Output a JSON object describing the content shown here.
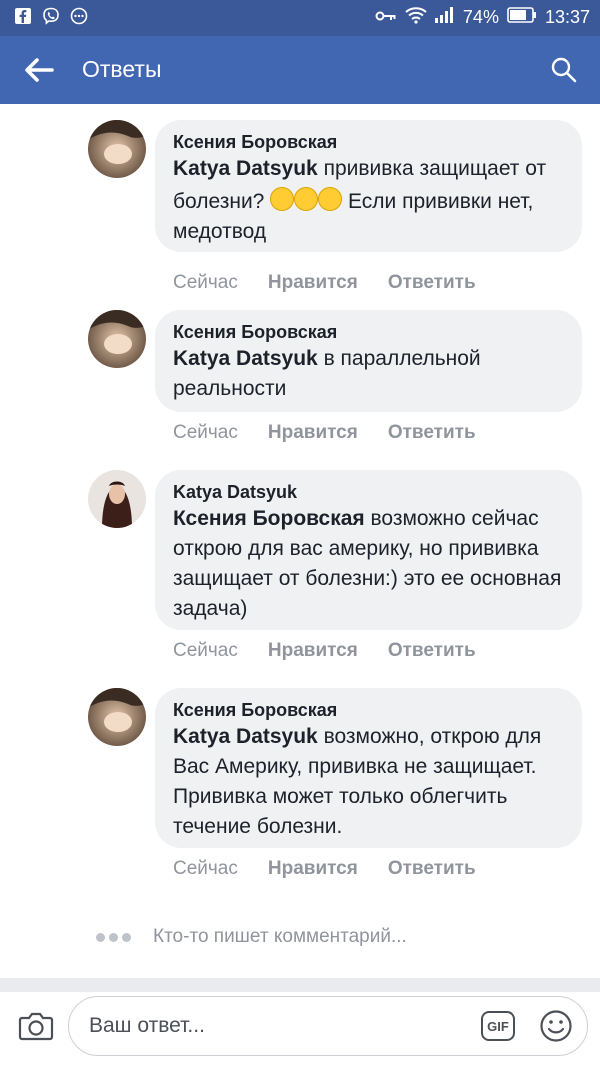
{
  "status_bar": {
    "battery": "74%",
    "time": "13:37"
  },
  "header": {
    "title": "Ответы"
  },
  "comments": [
    {
      "author": "Ксения Боровская",
      "mention": "Katya Datsyuk",
      "text_before_emoji": " прививка защищает от болезни? ",
      "text_after_emoji": " Если прививки нет, медотвод",
      "emoji_icon": "laughing-tears-emoji",
      "time": "Сейчас",
      "like": "Нравится",
      "reply": "Ответить"
    },
    {
      "author": "Ксения Боровская",
      "mention": "Katya Datsyuk",
      "text": " в параллельной реальности",
      "time": "Сейчас",
      "like": "Нравится",
      "reply": "Ответить"
    },
    {
      "author": "Katya Datsyuk",
      "mention": "Ксения Боровская",
      "text": " возможно сейчас открою для вас америку, но прививка защищает от болезни:) это ее основная задача)",
      "time": "Сейчас",
      "like": "Нравится",
      "reply": "Ответить"
    },
    {
      "author": "Ксения Боровская",
      "mention": "Katya Datsyuk",
      "text": " возможно, открою для Вас Америку, прививка не защищает. Прививка может только облегчить течение болезни.",
      "time": "Сейчас",
      "like": "Нравится",
      "reply": "Ответить"
    }
  ],
  "typing_indicator": "Кто-то пишет комментарий...",
  "composer": {
    "placeholder": "Ваш ответ...",
    "gif_label": "GIF"
  },
  "colors": {
    "brand": "#4267b2",
    "status_bar": "#3b5998",
    "bubble": "#f0f1f3",
    "meta_text": "#90949c"
  }
}
